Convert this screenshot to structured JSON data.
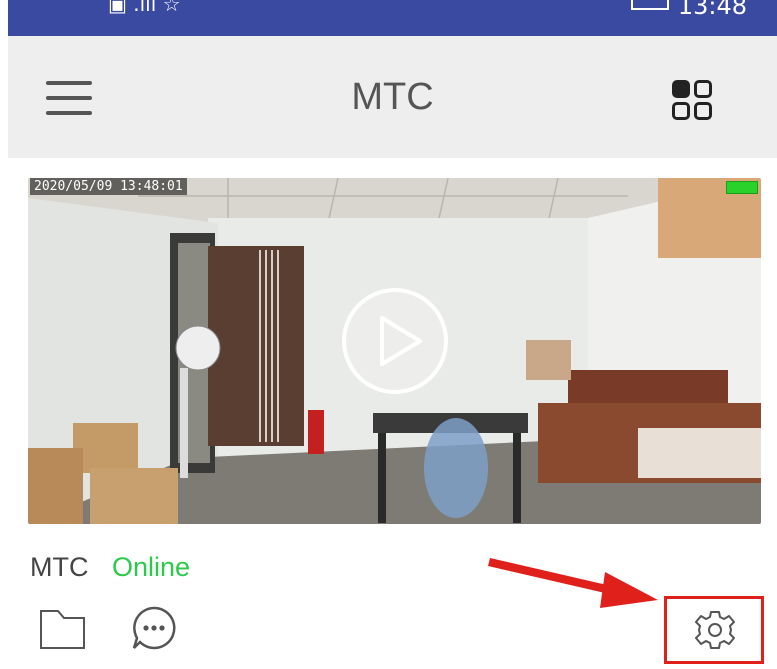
{
  "status_bar": {
    "left_icons": "▣ .ıll ☆",
    "time": "13:48"
  },
  "app_bar": {
    "title": "MTC"
  },
  "camera": {
    "timestamp": "2020/05/09 13:48:01"
  },
  "device": {
    "name": "MTC",
    "status": "Online"
  },
  "colors": {
    "status_bar": "#3a4aa0",
    "online": "#2cc94a",
    "highlight": "#e0201a"
  },
  "icons": [
    "menu-icon",
    "grid-view-icon",
    "play-icon",
    "folder-icon",
    "chat-icon",
    "settings-icon"
  ]
}
